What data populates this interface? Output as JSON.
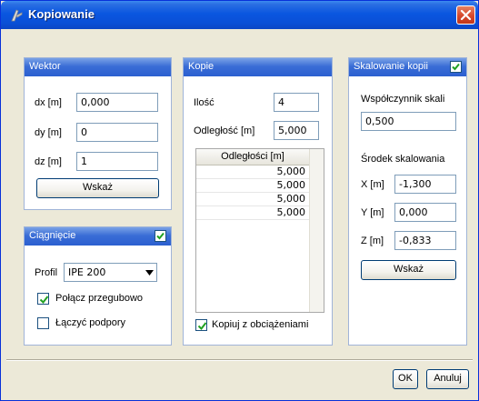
{
  "window": {
    "title": "Kopiowanie",
    "icon": "app-icon",
    "close_icon": "close-icon"
  },
  "wektor": {
    "title": "Wektor",
    "dx_label": "dx [m]",
    "dx_value": "0,000",
    "dy_label": "dy [m]",
    "dy_value": "0",
    "dz_label": "dz [m]",
    "dz_value": "1",
    "button": "Wskaż"
  },
  "ciagniecie": {
    "title": "Ciągnięcie",
    "checked": true,
    "profil_label": "Profil",
    "profil_value": "IPE 200",
    "polacz_label": "Połącz przegubowo",
    "polacz_checked": true,
    "laczyc_label": "Łączyć podpory",
    "laczyc_checked": false
  },
  "kopie": {
    "title": "Kopie",
    "ilosc_label": "Ilość",
    "ilosc_value": "4",
    "odleglosc_label": "Odległość [m]",
    "odleglosc_value": "5,000",
    "table_header": "Odległości [m]",
    "rows": [
      "5,000",
      "5,000",
      "5,000",
      "5,000"
    ],
    "kopiuj_label": "Kopiuj z obciążeniami",
    "kopiuj_checked": true
  },
  "skalowanie": {
    "title": "Skalowanie kopii",
    "checked": true,
    "wsp_label": "Współczynnik skali",
    "wsp_value": "0,500",
    "srodek_label": "Środek skalowania",
    "x_label": "X [m]",
    "x_value": "-1,300",
    "y_label": "Y [m]",
    "y_value": "0,000",
    "z_label": "Z [m]",
    "z_value": "-0,833",
    "button": "Wskaż"
  },
  "footer": {
    "ok": "OK",
    "cancel": "Anuluj"
  },
  "colors": {
    "title_bar": "#0a56e0",
    "panel_header": "#3a6dd6",
    "dialog_bg": "#ece9d8",
    "check": "#21a121"
  }
}
